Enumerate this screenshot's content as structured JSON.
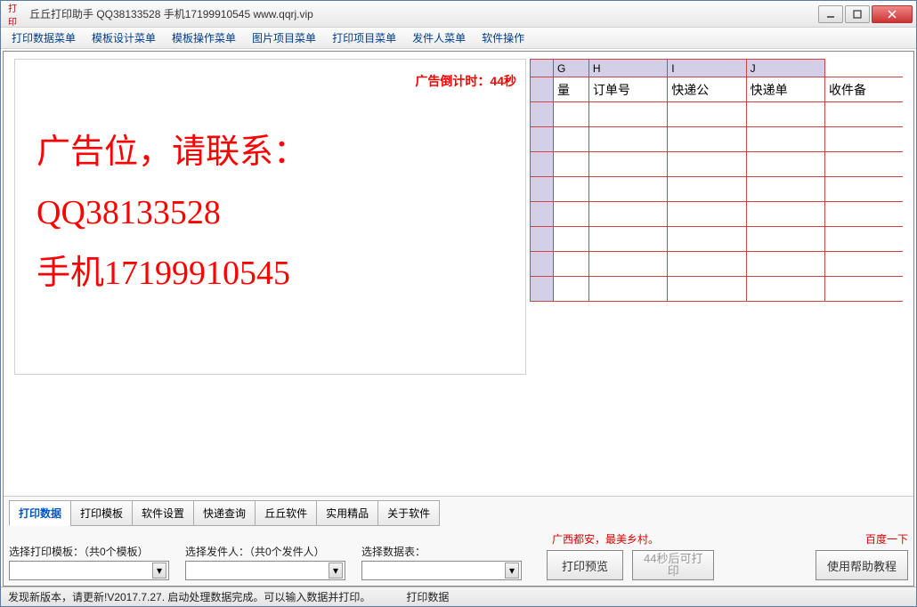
{
  "title": "丘丘打印助手  QQ38133528  手机17199910545  www.qqrj.vip",
  "menus": [
    "打印数据菜单",
    "模板设计菜单",
    "模板操作菜单",
    "图片项目菜单",
    "打印项目菜单",
    "发件人菜单",
    "软件操作"
  ],
  "ad": {
    "countdown": "广告倒计时：44秒",
    "line1": "广告位，请联系：",
    "line2": "QQ38133528",
    "line3": "手机17199910545"
  },
  "grid": {
    "cols": [
      "G",
      "H",
      "I",
      "J"
    ],
    "labels": [
      "量",
      "订单号",
      "快递公",
      "快递单",
      "收件备"
    ]
  },
  "tabs": [
    "打印数据",
    "打印模板",
    "软件设置",
    "快递查询",
    "丘丘软件",
    "实用精品",
    "关于软件"
  ],
  "controls": {
    "template_label": "选择打印模板：（共0个模板）",
    "sender_label": "选择发件人：（共0个发件人）",
    "table_label": "选择数据表：",
    "slogan": "广西都安，最美乡村。",
    "preview_btn": "打印预览",
    "print_btn": "44秒后可打印",
    "baidu": "百度一下",
    "help_btn": "使用帮助教程"
  },
  "status": {
    "left": "发现新版本，请更新!V2017.7.27. 启动处理数据完成。可以输入数据并打印。",
    "right": "打印数据"
  }
}
